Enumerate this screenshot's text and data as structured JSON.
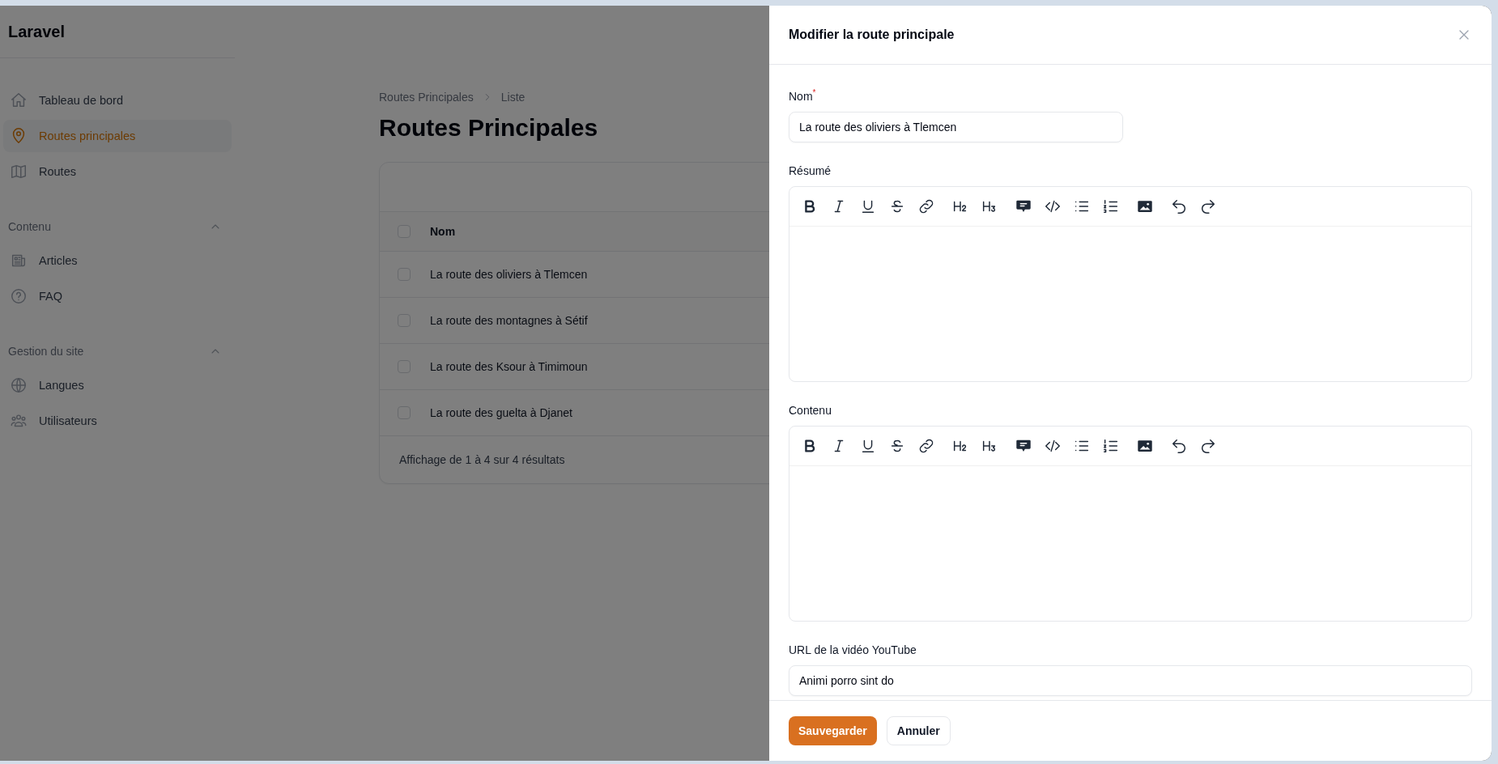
{
  "app": {
    "brand": "Laravel"
  },
  "sidebar": {
    "groups": [
      {
        "items": [
          {
            "label": "Tableau de bord",
            "kind": "home",
            "selected": false
          },
          {
            "label": "Routes principales",
            "kind": "pin",
            "selected": true
          },
          {
            "label": "Routes",
            "kind": "map",
            "selected": false
          }
        ]
      },
      {
        "label": "Contenu",
        "expanded": true,
        "items": [
          {
            "label": "Articles",
            "kind": "newspaper",
            "selected": false
          },
          {
            "label": "FAQ",
            "kind": "question",
            "selected": false
          }
        ]
      },
      {
        "label": "Gestion du site",
        "expanded": true,
        "items": [
          {
            "label": "Langues",
            "kind": "globe",
            "selected": false
          },
          {
            "label": "Utilisateurs",
            "kind": "users",
            "selected": false
          }
        ]
      }
    ]
  },
  "page": {
    "breadcrumbs": [
      "Routes Principales",
      "Liste"
    ],
    "title": "Routes Principales",
    "table": {
      "all_checked": false,
      "columns": [
        "Nom"
      ],
      "rows": [
        {
          "checked": false,
          "cells": [
            "La route des oliviers à Tlemcen"
          ]
        },
        {
          "checked": false,
          "cells": [
            "La route des montagnes à Sétif"
          ]
        },
        {
          "checked": false,
          "cells": [
            "La route des Ksour à Timimoun"
          ]
        },
        {
          "checked": false,
          "cells": [
            "La route des guelta à Djanet"
          ]
        }
      ],
      "summary": "Affichage de 1 à 4 sur 4 résultats"
    }
  },
  "modal": {
    "title": "Modifier la route principale",
    "fields": [
      {
        "kind": "text",
        "label": "Nom$^{*}$",
        "value": "La route des oliviers à Tlemcen"
      },
      {
        "kind": "editor",
        "label": "Résumé",
        "toolbar": [
          [
            {
              "kind": "bold"
            },
            {
              "kind": "italic"
            },
            {
              "kind": "underline"
            },
            {
              "kind": "strike"
            },
            {
              "kind": "link"
            }
          ],
          [
            {
              "kind": "h2"
            },
            {
              "kind": "h3"
            }
          ],
          [
            {
              "kind": "quote"
            },
            {
              "kind": "code"
            },
            {
              "kind": "bullets"
            },
            {
              "kind": "numbers"
            }
          ],
          [
            {
              "kind": "image"
            }
          ],
          [
            {
              "kind": "undo"
            },
            {
              "kind": "redo"
            }
          ]
        ]
      },
      {
        "kind": "editor",
        "label": "Contenu",
        "toolbar": [
          [
            {
              "kind": "bold"
            },
            {
              "kind": "italic"
            },
            {
              "kind": "underline"
            },
            {
              "kind": "strike"
            },
            {
              "kind": "link"
            }
          ],
          [
            {
              "kind": "h2"
            },
            {
              "kind": "h3"
            }
          ],
          [
            {
              "kind": "quote"
            },
            {
              "kind": "code"
            },
            {
              "kind": "bullets"
            },
            {
              "kind": "numbers"
            }
          ],
          [
            {
              "kind": "image"
            }
          ],
          [
            {
              "kind": "undo"
            },
            {
              "kind": "redo"
            }
          ]
        ]
      },
      {
        "kind": "url",
        "label": "URL de la vidéo YouTube",
        "value": "Animi porro sint do"
      }
    ],
    "buttons": [
      {
        "label": "Sauvegarder",
        "kind": "primary"
      },
      {
        "label": "Annuler",
        "kind": "secondary"
      }
    ]
  }
}
